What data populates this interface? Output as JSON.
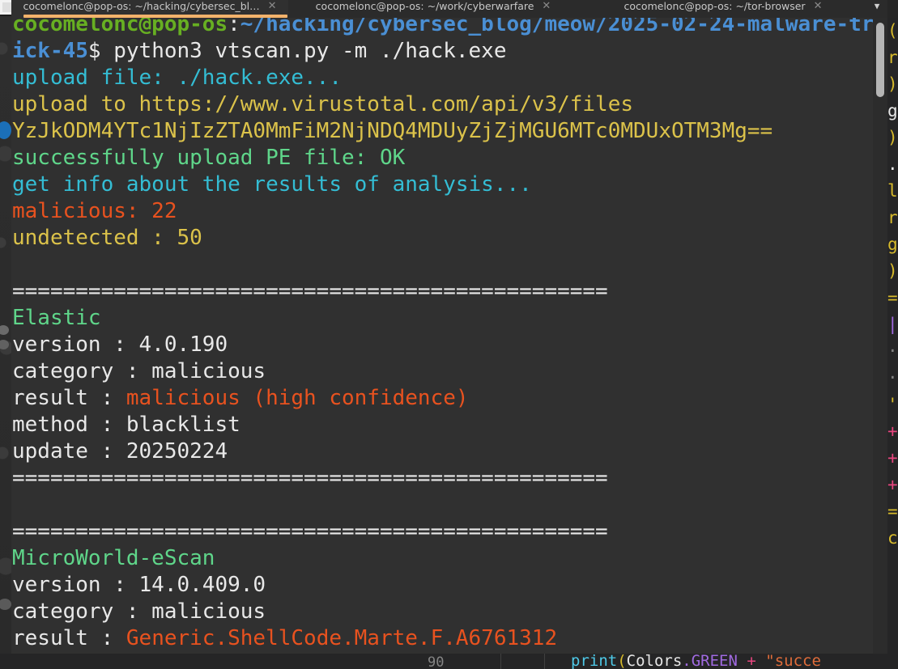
{
  "window": {
    "title": "cocomelonc@pop-os: ~/hacking/cybersec_bl…",
    "tab_list_icon": "chevron-down-icon"
  },
  "tabs": [
    {
      "label": "cocomelonc@pop-os: ~/hacking/cybersec_bl…",
      "close": "✕",
      "active": true
    },
    {
      "label": "cocomelonc@pop-os: ~/work/cyberwarfare",
      "close": "✕",
      "active": false
    },
    {
      "label": "cocomelonc@pop-os: ~/tor-browser",
      "close": "✕",
      "active": false
    }
  ],
  "colors": {
    "accent_tab_underline": "#f2b26b",
    "prompt_user": "#67af22",
    "prompt_path": "#4a8fd4",
    "info": "#34bdd4",
    "warn": "#dbc24a",
    "success": "#5fd68a",
    "danger": "#e8521f",
    "terminal_bg": "#303030",
    "text": "#e6e6e6"
  },
  "terminal": {
    "prompt": {
      "user_host": "cocomelonc@pop-os",
      "separator": ":",
      "path": "~/hacking/cybersec_blog/meow/2025-02-24-malware-trick-45",
      "sigil": "$",
      "command": " python3 vtscan.py -m ./hack.exe"
    },
    "lines": [
      {
        "segments": [
          {
            "text": "upload file: ./hack.exe...",
            "color": "cyan"
          }
        ]
      },
      {
        "segments": [
          {
            "text": "upload to https://www.virustotal.com/api/v3/files",
            "color": "yellow"
          }
        ]
      },
      {
        "segments": [
          {
            "text": "YzJkODM4YTc1NjIzZTA0MmFiM2NjNDQ4MDUyZjZjMGU6MTc0MDUxOTM3Mg==",
            "color": "yellow"
          }
        ]
      },
      {
        "segments": [
          {
            "text": "successfully upload PE file: OK",
            "color": "lgreen"
          }
        ]
      },
      {
        "segments": [
          {
            "text": "get info about the results of analysis...",
            "color": "cyan"
          }
        ]
      },
      {
        "segments": [
          {
            "text": "malicious: 22",
            "color": "orange"
          }
        ]
      },
      {
        "segments": [
          {
            "text": "undetected : 50",
            "color": "yellow"
          }
        ]
      },
      {
        "segments": [
          {
            "text": "",
            "color": "white"
          }
        ]
      },
      {
        "segments": [
          {
            "text": "===============================================",
            "color": "white"
          }
        ]
      },
      {
        "segments": [
          {
            "text": "Elastic",
            "color": "lgreen"
          }
        ]
      },
      {
        "segments": [
          {
            "text": "version : 4.0.190",
            "color": "white"
          }
        ]
      },
      {
        "segments": [
          {
            "text": "category : malicious",
            "color": "white"
          }
        ]
      },
      {
        "segments": [
          {
            "text": "result : ",
            "color": "white"
          },
          {
            "text": "malicious (high confidence)",
            "color": "orange"
          }
        ]
      },
      {
        "segments": [
          {
            "text": "method : blacklist",
            "color": "white"
          }
        ]
      },
      {
        "segments": [
          {
            "text": "update : 20250224",
            "color": "white"
          }
        ]
      },
      {
        "segments": [
          {
            "text": "===============================================",
            "color": "white"
          }
        ]
      },
      {
        "segments": [
          {
            "text": "",
            "color": "white"
          }
        ]
      },
      {
        "segments": [
          {
            "text": "===============================================",
            "color": "white"
          }
        ]
      },
      {
        "segments": [
          {
            "text": "MicroWorld-eScan",
            "color": "lgreen"
          }
        ]
      },
      {
        "segments": [
          {
            "text": "version : 14.0.409.0",
            "color": "white"
          }
        ]
      },
      {
        "segments": [
          {
            "text": "category : malicious",
            "color": "white"
          }
        ]
      },
      {
        "segments": [
          {
            "text": "result : ",
            "color": "white"
          },
          {
            "text": "Generic.ShellCode.Marte.F.A6761312",
            "color": "orange"
          }
        ]
      }
    ]
  },
  "background_editor": {
    "line_number": "90",
    "code_tokens": [
      {
        "text": "print",
        "kind": "fn"
      },
      {
        "text": "(",
        "kind": "par"
      },
      {
        "text": "Colors",
        "kind": "id"
      },
      {
        "text": ".GREEN",
        "kind": "prop"
      },
      {
        "text": " + ",
        "kind": "op"
      },
      {
        "text": "\"succe",
        "kind": "str"
      }
    ],
    "right_strip_chars": [
      "(",
      "r",
      ")",
      "g",
      ")",
      ".c",
      "le",
      "r",
      "g",
      ")",
      "=",
      "|",
      "·",
      "·",
      "'",
      "+",
      "+",
      "+",
      "=",
      "c"
    ]
  }
}
